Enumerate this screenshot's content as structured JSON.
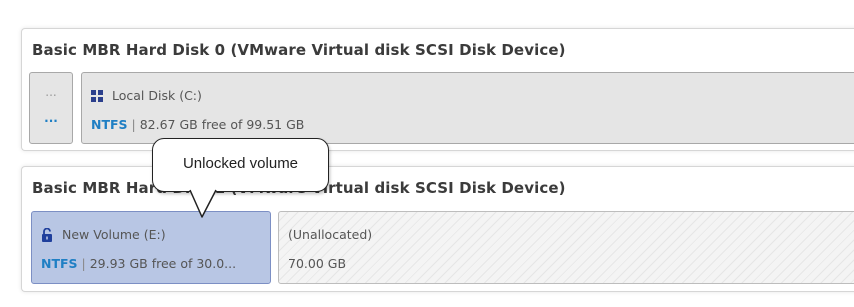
{
  "disks": [
    {
      "title": "Basic MBR Hard Disk 0 (VMware Virtual disk SCSI Disk Device)",
      "small_partition": {
        "top_dots": "...",
        "bottom_dots": "..."
      },
      "partitions": [
        {
          "icon": "windows-icon",
          "name": "Local Disk (C:)",
          "filesystem": "NTFS",
          "separator": "|",
          "space": "82.67 GB free of 99.51 GB"
        }
      ]
    },
    {
      "title": "Basic MBR Hard Disk 1 (VMware Virtual disk SCSI Disk Device)",
      "partitions": [
        {
          "icon": "unlocked-lock-icon",
          "name": "New Volume (E:)",
          "filesystem": "NTFS",
          "separator": "|",
          "space": "29.93 GB free of 30.0...",
          "selected": true
        },
        {
          "name": "(Unallocated)",
          "size": "70.00 GB"
        }
      ]
    }
  ],
  "callout": {
    "text": "Unlocked volume"
  },
  "colors": {
    "filesystem_label": "#1f7fc4",
    "selected_partition": "#b8c6e4",
    "partition_bg": "#e5e5e5",
    "windows_icon": "#2b3f8c",
    "lock_icon": "#1f3f9c"
  }
}
